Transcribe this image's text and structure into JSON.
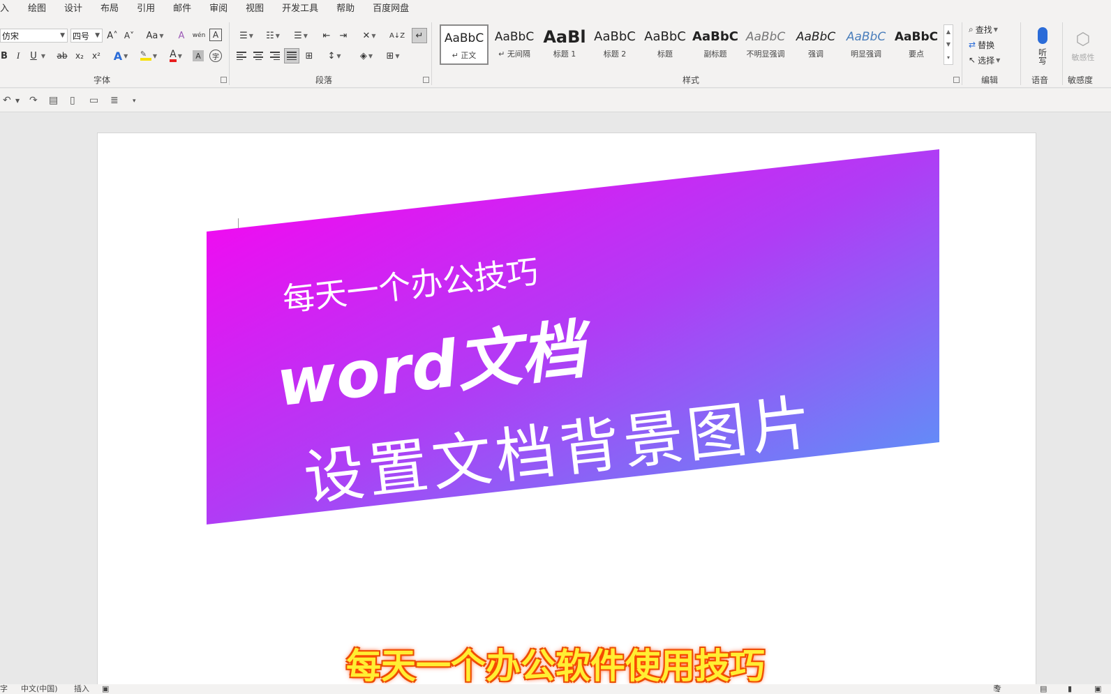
{
  "menu": [
    "入",
    "绘图",
    "设计",
    "布局",
    "引用",
    "邮件",
    "审阅",
    "视图",
    "开发工具",
    "帮助",
    "百度网盘"
  ],
  "font_group": {
    "font_name": "仿宋",
    "font_size": "四号",
    "grow_label": "A˄",
    "shrink_label": "A˅",
    "case_label": "Aa",
    "phonetic_label": "wén",
    "border_label": "A",
    "bold": "B",
    "italic": "I",
    "underline": "U",
    "strike": "ab",
    "subscript": "x₂",
    "superscript": "x²",
    "text_effect": "A",
    "font_color": "A",
    "char_shade": "A",
    "enclose": "字",
    "label": "字体"
  },
  "paragraph_group": {
    "label": "段落",
    "sort_label": "A↓Z"
  },
  "styles_group": {
    "label": "样式",
    "items": [
      {
        "sample": "AaBbC",
        "name": "↵ 正文"
      },
      {
        "sample": "AaBbC",
        "name": "↵ 无间隔"
      },
      {
        "sample": "AaBl",
        "name": "标题 1"
      },
      {
        "sample": "AaBbC",
        "name": "标题 2"
      },
      {
        "sample": "AaBbC",
        "name": "标题"
      },
      {
        "sample": "AaBbC",
        "name": "副标题"
      },
      {
        "sample": "AaBbC",
        "name": "不明显强调"
      },
      {
        "sample": "AaBbC",
        "name": "强调"
      },
      {
        "sample": "AaBbC",
        "name": "明显强调"
      },
      {
        "sample": "AaBbC",
        "name": "要点"
      }
    ]
  },
  "editing_group": {
    "label": "编辑",
    "find": "查找",
    "replace": "替换",
    "select": "选择"
  },
  "voice_group": {
    "label": "语音",
    "dictate": "听写"
  },
  "sensitivity_group": {
    "label": "敏感度",
    "button": "敏感性"
  },
  "document": {
    "banner_small": "每天一个办公技巧",
    "banner_title": "word文档",
    "banner_subtitle": "设置文档背景图片",
    "gradient_start": "#ff00f0",
    "gradient_mid": "#b03cf5",
    "gradient_end": "#4fa0f8"
  },
  "caption": "每天一个办公软件使用技巧",
  "status": {
    "words": "字",
    "language": "中文(中国)",
    "mode": "插入",
    "focus": "专注"
  },
  "colors": {
    "highlight": "#f7e00a",
    "font_red": "#e81e1e",
    "accent": "#2b579a"
  }
}
